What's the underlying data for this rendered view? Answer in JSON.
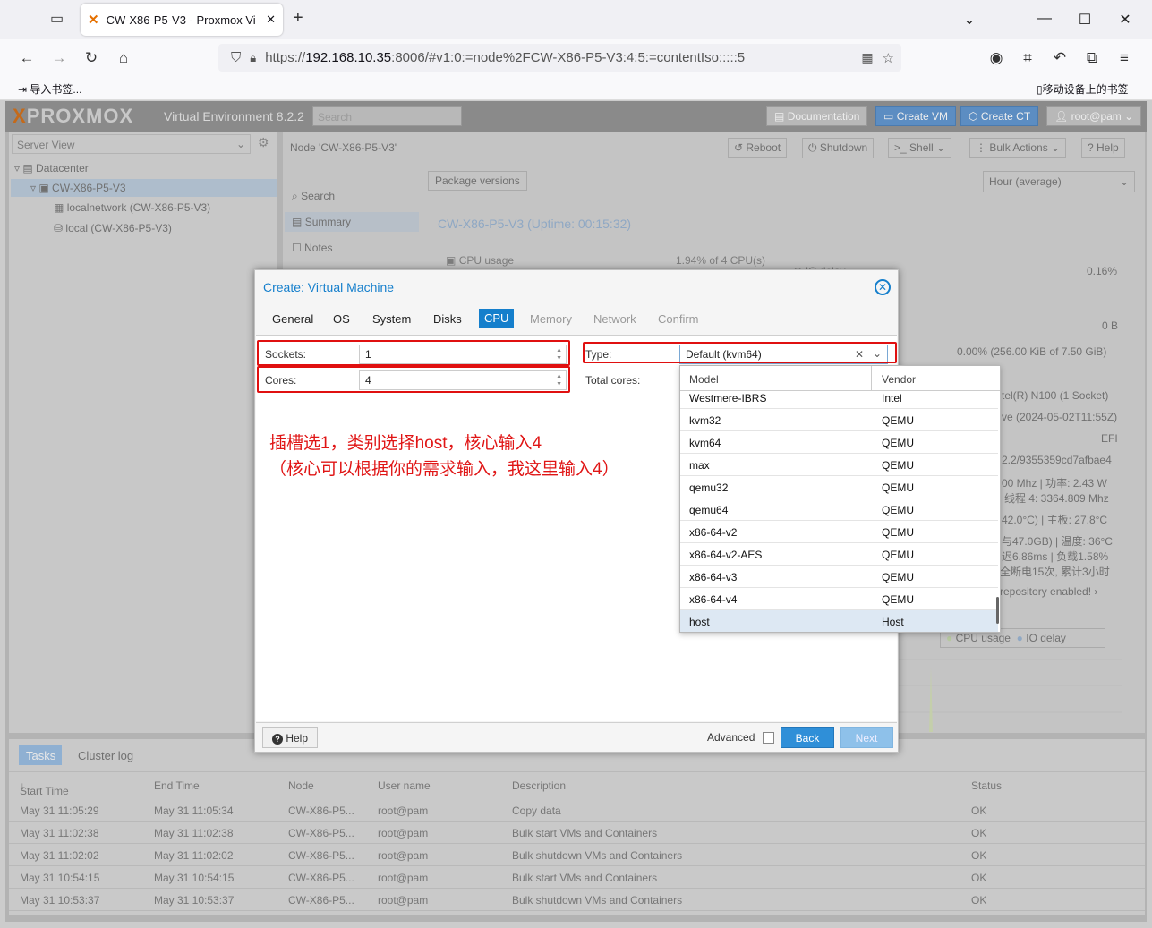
{
  "browser": {
    "tab_title": "CW-X86-P5-V3 - Proxmox Vi",
    "url_prefix": "https://",
    "url_host": "192.168.10.35",
    "url_rest": ":8006/#v1:0:=node%2FCW-X86-P5-V3:4:5:=contentIso:::::5",
    "bookmark_import": "导入书签...",
    "bookmark_mobile": "移动设备上的书签"
  },
  "pve": {
    "logo": "PROXMOX",
    "product": "Virtual Environment 8.2.2",
    "search_placeholder": "Search",
    "header_buttons": {
      "docs": "Documentation",
      "create_vm": "Create VM",
      "create_ct": "Create CT",
      "user": "root@pam"
    },
    "server_view": "Server View",
    "tree": {
      "datacenter": "Datacenter",
      "node": "CW-X86-P5-V3",
      "localnetwork": "localnetwork (CW-X86-P5-V3)",
      "local": "local (CW-X86-P5-V3)"
    },
    "node_title": "Node 'CW-X86-P5-V3'",
    "node_buttons": {
      "reboot": "Reboot",
      "shutdown": "Shutdown",
      "shell": "Shell",
      "bulk": "Bulk Actions",
      "help": "Help"
    },
    "menu": {
      "search": "Search",
      "summary": "Summary",
      "notes": "Notes"
    },
    "package_versions": "Package versions",
    "timeframe": "Hour (average)",
    "uptime": "CW-X86-P5-V3 (Uptime: 00:15:32)",
    "cpu_usage_label": "CPU usage",
    "cpu_usage_value": "1.94% of 4 CPU(s)",
    "io_delay_label": "IO delay",
    "io_delay_value": "0.16%",
    "ksm": "0 B",
    "swap": "0.00% (256.00 KiB of 7.50 GiB)",
    "cpu_model": "tel(R) N100 (1 Socket)",
    "kernel": "ve (2024-05-02T11:55Z)",
    "boot": "EFI",
    "pve_manager": "2.2/9355359cd7afbae4",
    "freq1": "00 Mhz | 功率: 2.43 W",
    "freq2": "线程 4: 3364.809 Mhz",
    "temp": "42.0°C) | 主板: 27.8°C",
    "disk": "与47.0GB) | 温度: 36°C",
    "ping": "迟6.86ms | 负载1.58%",
    "power": "全断电15次, 累计3小时",
    "repo": "repository enabled!",
    "legend": {
      "cpu": "CPU usage",
      "io": "IO delay"
    },
    "tasks_tab": "Tasks",
    "cluster_tab": "Cluster log",
    "task_columns": [
      "Start Time",
      "End Time",
      "Node",
      "User name",
      "Description",
      "Status"
    ],
    "tasks": [
      {
        "start": "May 31 11:05:29",
        "end": "May 31 11:05:34",
        "node": "CW-X86-P5...",
        "user": "root@pam",
        "desc": "Copy data",
        "status": "OK"
      },
      {
        "start": "May 31 11:02:38",
        "end": "May 31 11:02:38",
        "node": "CW-X86-P5...",
        "user": "root@pam",
        "desc": "Bulk start VMs and Containers",
        "status": "OK"
      },
      {
        "start": "May 31 11:02:02",
        "end": "May 31 11:02:02",
        "node": "CW-X86-P5...",
        "user": "root@pam",
        "desc": "Bulk shutdown VMs and Containers",
        "status": "OK"
      },
      {
        "start": "May 31 10:54:15",
        "end": "May 31 10:54:15",
        "node": "CW-X86-P5...",
        "user": "root@pam",
        "desc": "Bulk start VMs and Containers",
        "status": "OK"
      },
      {
        "start": "May 31 10:53:37",
        "end": "May 31 10:53:37",
        "node": "CW-X86-P5...",
        "user": "root@pam",
        "desc": "Bulk shutdown VMs and Containers",
        "status": "OK"
      }
    ]
  },
  "dialog": {
    "title": "Create: Virtual Machine",
    "tabs": [
      "General",
      "OS",
      "System",
      "Disks",
      "CPU",
      "Memory",
      "Network",
      "Confirm"
    ],
    "sockets_label": "Sockets:",
    "sockets_value": "1",
    "cores_label": "Cores:",
    "cores_value": "4",
    "type_label": "Type:",
    "type_value": "Default (kvm64)",
    "total_cores_label": "Total cores:",
    "annotation_line1": "插槽选1，类别选择host，核心输入4",
    "annotation_line2": "（核心可以根据你的需求输入，我这里输入4）",
    "help": "Help",
    "advanced": "Advanced",
    "back": "Back",
    "next": "Next",
    "dropdown": {
      "col_model": "Model",
      "col_vendor": "Vendor",
      "rows": [
        {
          "model": "Westmere-IBRS",
          "vendor": "Intel"
        },
        {
          "model": "kvm32",
          "vendor": "QEMU"
        },
        {
          "model": "kvm64",
          "vendor": "QEMU"
        },
        {
          "model": "max",
          "vendor": "QEMU"
        },
        {
          "model": "qemu32",
          "vendor": "QEMU"
        },
        {
          "model": "qemu64",
          "vendor": "QEMU"
        },
        {
          "model": "x86-64-v2",
          "vendor": "QEMU"
        },
        {
          "model": "x86-64-v2-AES",
          "vendor": "QEMU"
        },
        {
          "model": "x86-64-v3",
          "vendor": "QEMU"
        },
        {
          "model": "x86-64-v4",
          "vendor": "QEMU"
        },
        {
          "model": "host",
          "vendor": "Host"
        }
      ]
    }
  }
}
